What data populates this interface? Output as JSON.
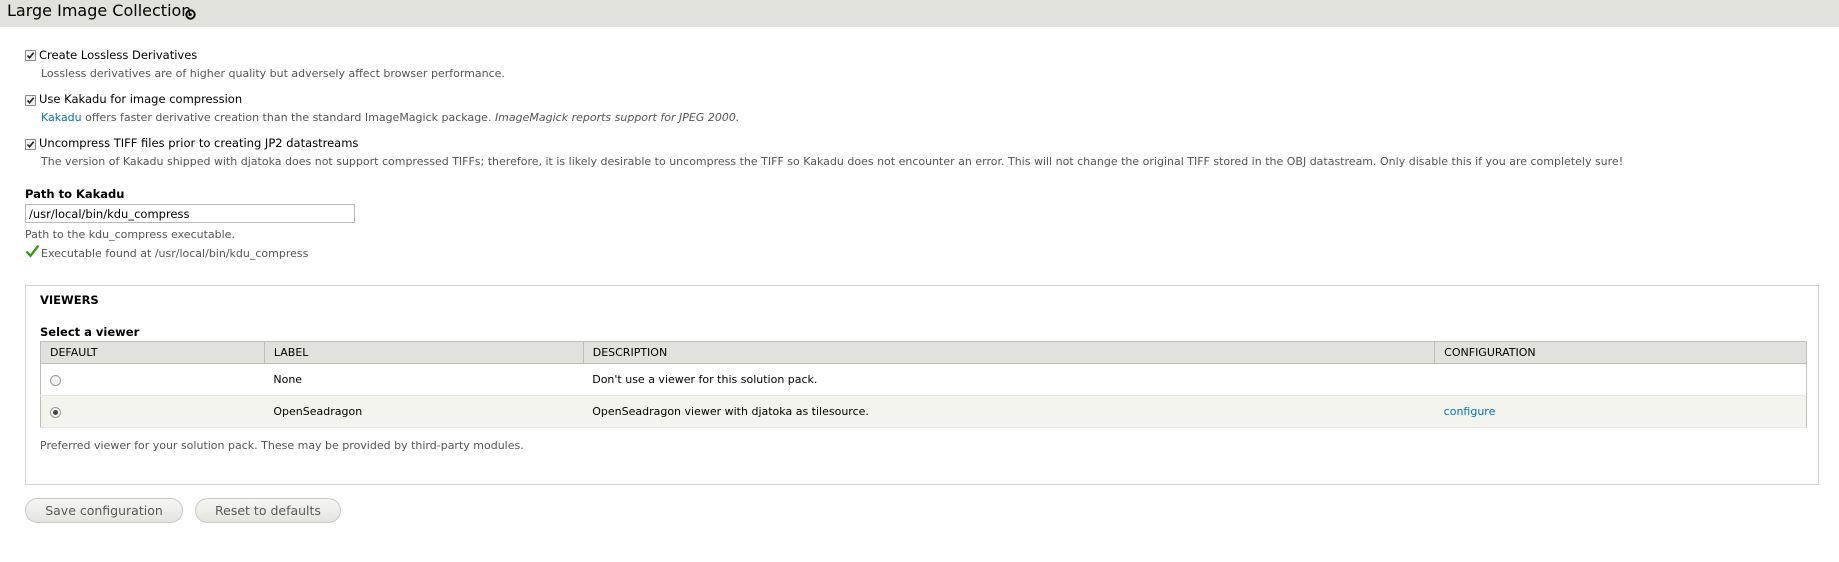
{
  "header": {
    "title": "Large Image Collection",
    "gear_icon": "gear-icon"
  },
  "options": {
    "lossless": {
      "checked": true,
      "label": "Create Lossless Derivatives",
      "description": "Lossless derivatives are of higher quality but adversely affect browser performance."
    },
    "kakadu": {
      "checked": true,
      "label": "Use Kakadu for image compression",
      "description_link": "Kakadu",
      "description_text": "offers faster derivative creation than the standard ImageMagick package.",
      "description_italic": "ImageMagick reports support for JPEG 2000."
    },
    "uncompress": {
      "checked": true,
      "label": "Uncompress TIFF files prior to creating JP2 datastreams",
      "description": "The version of Kakadu shipped with djatoka does not support compressed TIFFs; therefore, it is likely desirable to uncompress the TIFF so Kakadu does not encounter an error. This will not change the original TIFF stored in the OBJ datastream. Only disable this if you are completely sure!"
    }
  },
  "kakadu_path": {
    "title": "Path to Kakadu",
    "value": "/usr/local/bin/kdu_compress",
    "description": "Path to the kdu_compress executable.",
    "status": "Executable found at /usr/local/bin/kdu_compress",
    "status_icon": "checkmark-icon",
    "status_color": "#3a9a1a"
  },
  "viewers": {
    "legend": "VIEWERS",
    "select_label": "Select a viewer",
    "columns": [
      "DEFAULT",
      "LABEL",
      "DESCRIPTION",
      "CONFIGURATION"
    ],
    "rows": [
      {
        "selected": false,
        "label": "None",
        "description": "Don't use a viewer for this solution pack.",
        "configuration": ""
      },
      {
        "selected": true,
        "label": "OpenSeadragon",
        "description": "OpenSeadragon viewer with djatoka as tilesource.",
        "configuration": "configure"
      }
    ],
    "help": "Preferred viewer for your solution pack. These may be provided by third-party modules."
  },
  "buttons": {
    "save": "Save configuration",
    "reset": "Reset to defaults"
  },
  "colors": {
    "header_bg": "#e1e2dc",
    "link": "#0074bd"
  }
}
